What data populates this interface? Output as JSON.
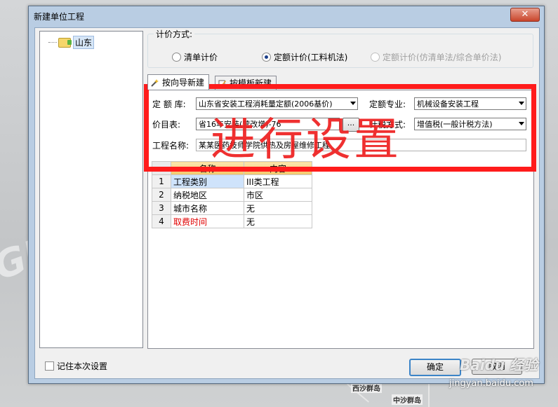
{
  "window": {
    "title": "新建单位工程",
    "close_glyph": "✕"
  },
  "tree": {
    "root_label": "山东"
  },
  "pricing": {
    "legend": "计价方式:",
    "options": [
      {
        "label": "清单计价",
        "checked": false,
        "disabled": false
      },
      {
        "label": "定额计价(工料机法)",
        "checked": true,
        "disabled": false
      },
      {
        "label": "定额计价(仿清单法/综合单价法)",
        "checked": false,
        "disabled": true
      }
    ]
  },
  "tabs": [
    {
      "label": "按向导新建",
      "active": true,
      "icon": "wizard-icon"
    },
    {
      "label": "按模板新建",
      "active": false,
      "icon": "template-icon"
    }
  ],
  "form": {
    "quota_lib_label": "定 额 库:",
    "quota_lib_value": "山东省安装工程消耗量定额(2006基价)",
    "quota_major_label": "定额专业:",
    "quota_major_value": "机械设备安装工程",
    "price_table_label": "价目表:",
    "price_table_value": "省16年安装(营改增)-76",
    "price_table_button": "...",
    "tax_method_label": "计税方式:",
    "tax_method_value": "增值税(一般计税方法)",
    "project_name_label": "工程名称:",
    "project_name_value": "某某医药技师学院供热及房屋维修工程"
  },
  "grid": {
    "headers": [
      "名称",
      "内容"
    ],
    "rows": [
      {
        "num": "1",
        "name": "工程类别",
        "value": "III类工程",
        "highlight": false,
        "selected": true
      },
      {
        "num": "2",
        "name": "纳税地区",
        "value": "市区",
        "highlight": false,
        "selected": false
      },
      {
        "num": "3",
        "name": "城市名称",
        "value": "无",
        "highlight": false,
        "selected": false
      },
      {
        "num": "4",
        "name": "取费时间",
        "value": "无",
        "highlight": true,
        "selected": false
      }
    ]
  },
  "footer": {
    "remember_label": "记住本次设置",
    "ok_label": "确定",
    "cancel_label": "取消"
  },
  "overlay": {
    "annotation_text": "进行设置",
    "color": "#ff1b1b"
  },
  "map": {
    "label_a": "西沙群岛",
    "label_b": "中沙群岛"
  },
  "watermarks": {
    "baidu": "Baidu 经验",
    "url": "jingyan.baidu.com",
    "left": "GLO"
  }
}
